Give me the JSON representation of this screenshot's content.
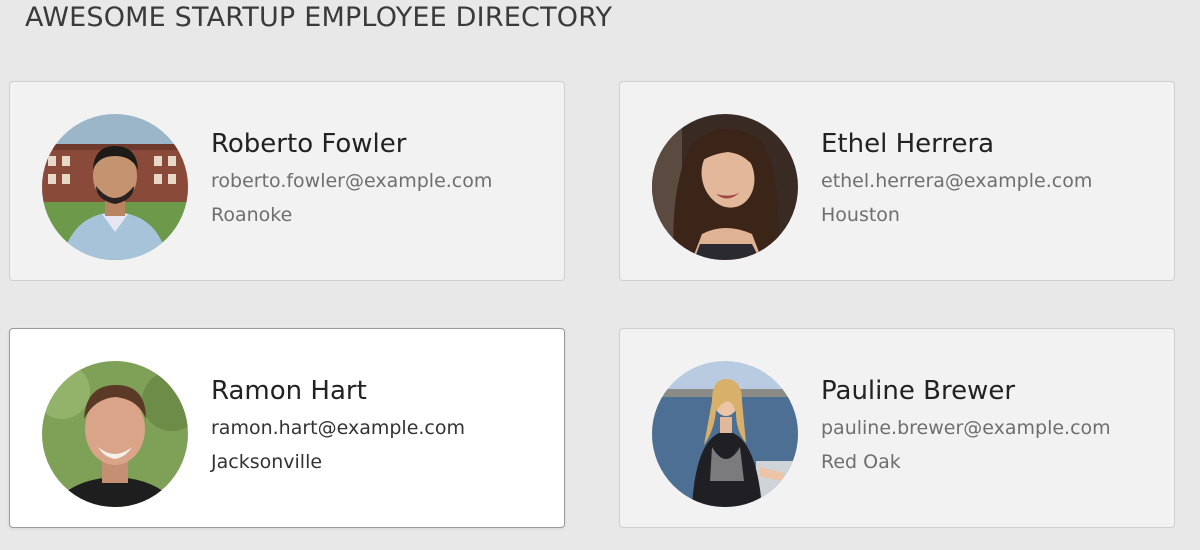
{
  "page": {
    "title": "AWESOME STARTUP EMPLOYEE DIRECTORY"
  },
  "employees": [
    {
      "name": "Roberto Fowler",
      "email": "roberto.fowler@example.com",
      "city": "Roanoke",
      "selected": false
    },
    {
      "name": "Ethel Herrera",
      "email": "ethel.herrera@example.com",
      "city": "Houston",
      "selected": false
    },
    {
      "name": "Ramon Hart",
      "email": "ramon.hart@example.com",
      "city": "Jacksonville",
      "selected": true
    },
    {
      "name": "Pauline Brewer",
      "email": "pauline.brewer@example.com",
      "city": "Red Oak",
      "selected": false
    }
  ],
  "colors": {
    "background": "#e8e8e8",
    "card": "#f2f2f2",
    "card_active": "#ffffff",
    "text_primary": "#222222",
    "text_secondary": "#6f6f6f"
  }
}
